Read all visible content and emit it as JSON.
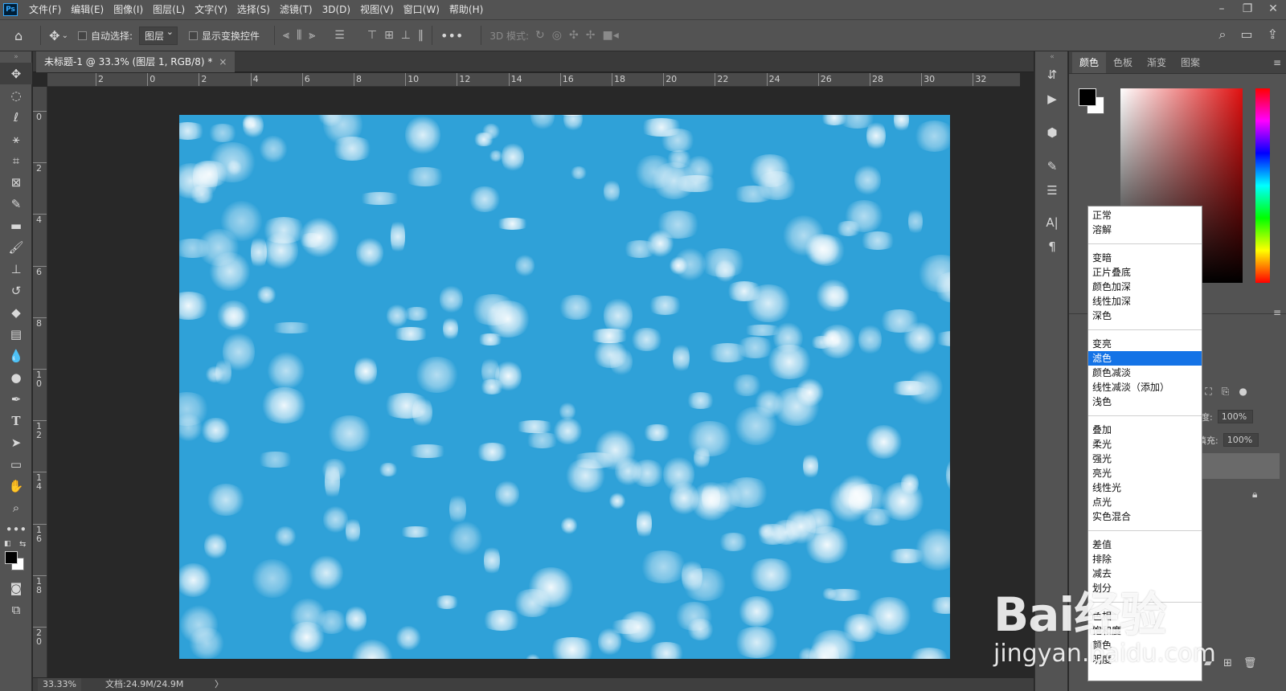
{
  "app": {
    "logo_text": "Ps"
  },
  "menubar": {
    "items": [
      "文件(F)",
      "编辑(E)",
      "图像(I)",
      "图层(L)",
      "文字(Y)",
      "选择(S)",
      "滤镜(T)",
      "3D(D)",
      "视图(V)",
      "窗口(W)",
      "帮助(H)"
    ]
  },
  "optionsbar": {
    "auto_select_label": "自动选择:",
    "auto_select_value": "图层",
    "show_transform_label": "显示变换控件",
    "mode_3d_label": "3D 模式:"
  },
  "document": {
    "tab_title": "未标题-1 @ 33.3% (图层 1, RGB/8) *",
    "zoom": "33.33%",
    "doc_info": "文档:24.9M/24.9M",
    "status_arrow": "〉",
    "ruler_h_labels": [
      "2",
      "0",
      "2",
      "4",
      "6",
      "8",
      "10",
      "12",
      "14",
      "16",
      "18",
      "20",
      "22",
      "24",
      "26",
      "28",
      "30",
      "32"
    ],
    "ruler_v_labels": [
      "0",
      "2",
      "4",
      "6",
      "8",
      "10",
      "12",
      "14",
      "16",
      "18",
      "20"
    ],
    "canvas_color": "#2fa1d8"
  },
  "panels": {
    "tabs": [
      "颜色",
      "色板",
      "渐变",
      "图案"
    ],
    "active_tab": "颜色",
    "opacity_label": "透明度:",
    "opacity_value": "100%",
    "fill_label": "填充:",
    "fill_value": "100%"
  },
  "blend_menu": {
    "groups": [
      [
        "正常",
        "溶解"
      ],
      [
        "变暗",
        "正片叠底",
        "颜色加深",
        "线性加深",
        "深色"
      ],
      [
        "变亮",
        "滤色",
        "颜色减淡",
        "线性减淡（添加）",
        "浅色"
      ],
      [
        "叠加",
        "柔光",
        "强光",
        "亮光",
        "线性光",
        "点光",
        "实色混合"
      ],
      [
        "差值",
        "排除",
        "减去",
        "划分"
      ],
      [
        "色相",
        "饱和度",
        "颜色",
        "明度"
      ]
    ],
    "selected": "滤色"
  },
  "watermark": {
    "logo": "Bai经验",
    "url": "jingyan.baidu.com"
  }
}
